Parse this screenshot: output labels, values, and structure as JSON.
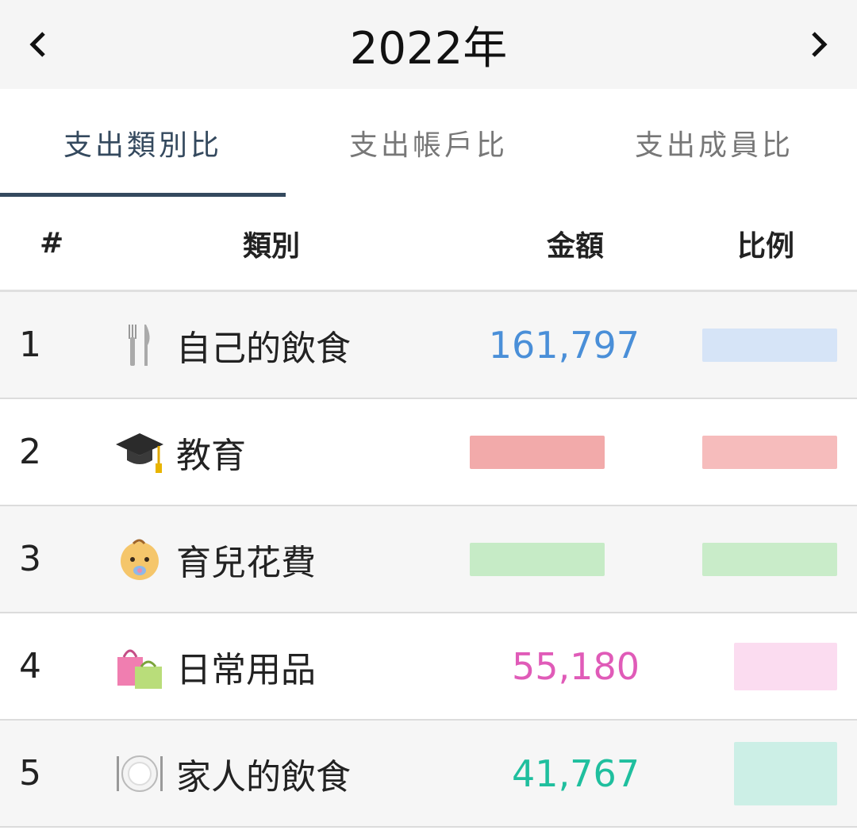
{
  "header": {
    "year": "2022年",
    "prev_icon": "chevron-left-icon",
    "next_icon": "chevron-right-icon"
  },
  "tabs": [
    {
      "label": "支出類別比",
      "active": true
    },
    {
      "label": "支出帳戶比",
      "active": false
    },
    {
      "label": "支出成員比",
      "active": false
    }
  ],
  "table": {
    "headers": {
      "index": "#",
      "category": "類別",
      "amount": "金額",
      "ratio": "比例"
    },
    "rows": [
      {
        "index": "1",
        "icon": "fork-knife-icon",
        "category": "自己的飲食",
        "amount": "161,797",
        "color": "#4a8fd8",
        "ratio_color": "#d6e4f7"
      },
      {
        "index": "2",
        "icon": "graduation-cap-icon",
        "category": "教育",
        "amount": "",
        "color": "#f2aaaa",
        "ratio_color": "#f6bcbc"
      },
      {
        "index": "3",
        "icon": "baby-icon",
        "category": "育兒花費",
        "amount": "",
        "color": "#c6ebc6",
        "ratio_color": "#c9ecc9"
      },
      {
        "index": "4",
        "icon": "shopping-bags-icon",
        "category": "日常用品",
        "amount": "55,180",
        "color": "#e05bb8",
        "ratio_color": "#fbdcf0"
      },
      {
        "index": "5",
        "icon": "plate-icon",
        "category": "家人的飲食",
        "amount": "41,767",
        "color": "#1fbf9e",
        "ratio_color": "#ccefe6"
      }
    ]
  }
}
